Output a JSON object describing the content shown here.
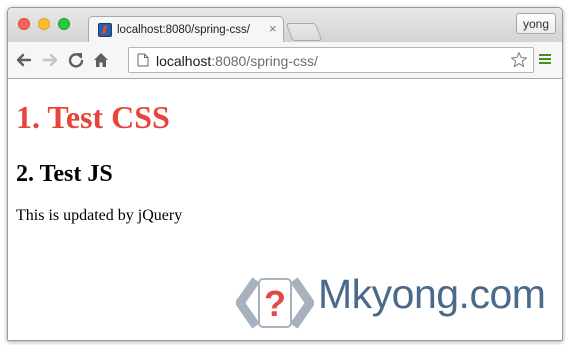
{
  "browser": {
    "tab": {
      "title": "localhost:8080/spring-css/",
      "close_glyph": "×",
      "favicon": "favicon-icon"
    },
    "profile_label": "yong",
    "toolbar": {
      "back_icon": "back-arrow-icon",
      "forward_icon": "forward-arrow-icon",
      "reload_icon": "reload-icon",
      "home_icon": "home-icon",
      "bookmark_icon": "star-icon",
      "menu_icon": "hamburger-menu-icon"
    },
    "address_bar": {
      "host": "localhost",
      "path": ":8080/spring-css/"
    }
  },
  "page": {
    "heading_css": "1. Test CSS",
    "heading_js": "2. Test JS",
    "paragraph": "This is updated by jQuery",
    "colors": {
      "css_heading": "#e7453b",
      "menu_icon": "#4a8f1e",
      "watermark": "#3a5e82"
    }
  },
  "watermark": {
    "text": "Mkyong.com",
    "logo_glyph": "?"
  }
}
